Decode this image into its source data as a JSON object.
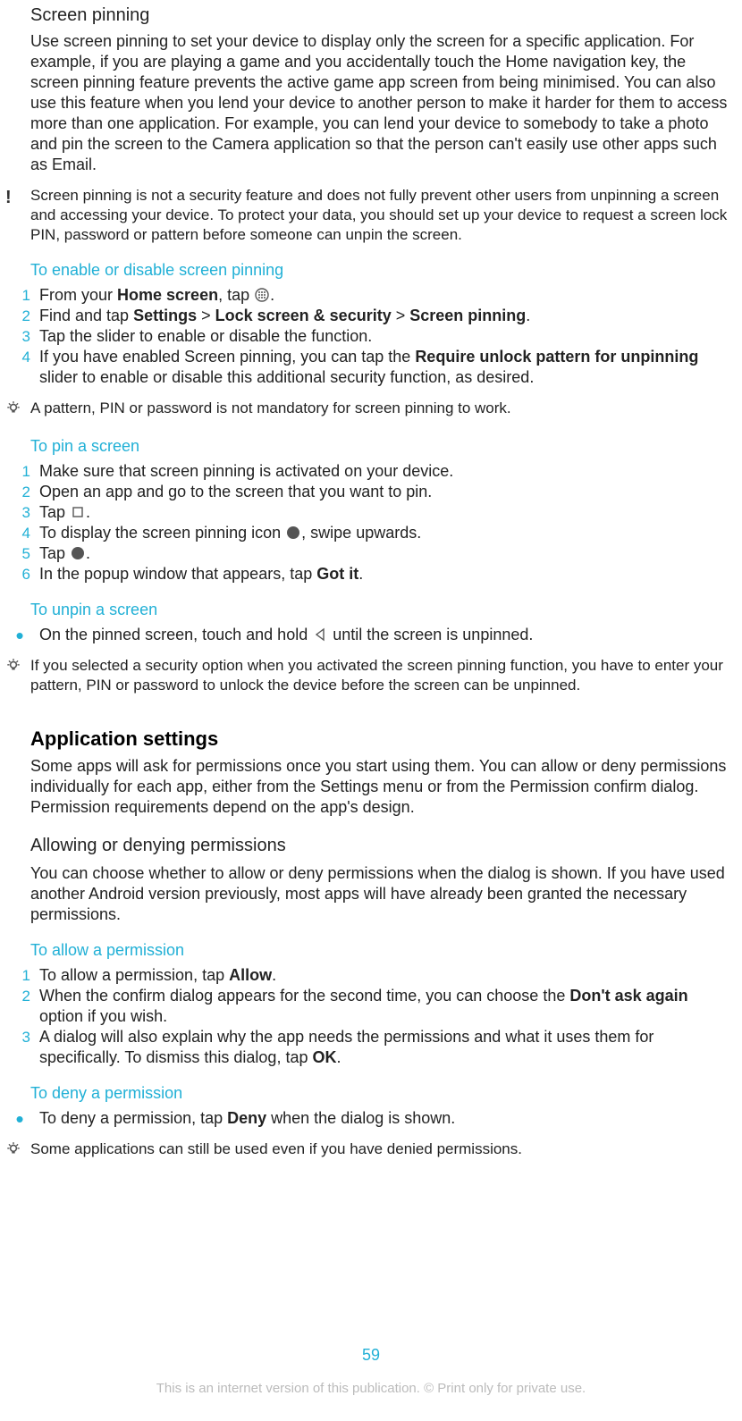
{
  "screenPinning": {
    "title": "Screen pinning",
    "intro": "Use screen pinning to set your device to display only the screen for a specific application. For example, if you are playing a game and you accidentally touch the Home navigation key, the screen pinning feature prevents the active game app screen from being minimised. You can also use this feature when you lend your device to another person to make it harder for them to access more than one application. For example, you can lend your device to somebody to take a photo and pin the screen to the Camera application so that the person can't easily use other apps such as Email.",
    "warning": "Screen pinning is not a security feature and does not fully prevent other users from unpinning a screen and accessing your device. To protect your data, you should set up your device to request a screen lock PIN, password or pattern before someone can unpin the screen.",
    "enable": {
      "heading": "To enable or disable screen pinning",
      "s1_pre": "From your ",
      "s1_bold": "Home screen",
      "s1_post": ", tap ",
      "s2_pre": "Find and tap ",
      "s2_b1": "Settings",
      "s2_b2": "Lock screen & security",
      "s2_b3": "Screen pinning",
      "s2_sep": " > ",
      "s3": "Tap the slider to enable or disable the function.",
      "s4_pre": "If you have enabled Screen pinning, you can tap the ",
      "s4_b": "Require unlock pattern for unpinning",
      "s4_post": " slider to enable or disable this additional security function, as desired.",
      "tip": "A pattern, PIN or password is not mandatory for screen pinning to work."
    },
    "pin": {
      "heading": "To pin a screen",
      "s1": "Make sure that screen pinning is activated on your device.",
      "s2": "Open an app and go to the screen that you want to pin.",
      "s3_pre": "Tap ",
      "s4_pre": "To display the screen pinning icon ",
      "s4_post": ", swipe upwards.",
      "s5_pre": "Tap ",
      "s6_pre": "In the popup window that appears, tap ",
      "s6_b": "Got it"
    },
    "unpin": {
      "heading": "To unpin a screen",
      "bullet_pre": "On the pinned screen, touch and hold ",
      "bullet_post": " until the screen is unpinned.",
      "tip": "If you selected a security option when you activated the screen pinning function, you have to enter your pattern, PIN or password to unlock the device before the screen can be unpinned."
    }
  },
  "appSettings": {
    "title": "Application settings",
    "intro": "Some apps will ask for permissions once you start using them. You can allow or deny permissions individually for each app, either from the Settings menu or from the Permission confirm dialog. Permission requirements depend on the app's design.",
    "allowDeny": {
      "heading": "Allowing or denying permissions",
      "para": "You can choose whether to allow or deny permissions when the dialog is shown. If you have used another Android version previously, most apps will have already been granted the necessary permissions."
    },
    "allow": {
      "heading": "To allow a permission",
      "s1_pre": "To allow a permission, tap ",
      "s1_b": "Allow",
      "s2_pre": "When the confirm dialog appears for the second time, you can choose the ",
      "s2_b": "Don't ask again",
      "s2_post": " option if you wish.",
      "s3_pre": "A dialog will also explain why the app needs the permissions and what it uses them for specifically. To dismiss this dialog, tap ",
      "s3_b": "OK"
    },
    "deny": {
      "heading": "To deny a permission",
      "bullet_pre": "To deny a permission, tap ",
      "bullet_b": "Deny",
      "bullet_post": " when the dialog is shown.",
      "tip": "Some applications can still be used even if you have denied permissions."
    }
  },
  "pageNumber": "59",
  "disclaimer": "This is an internet version of this publication. © Print only for private use."
}
